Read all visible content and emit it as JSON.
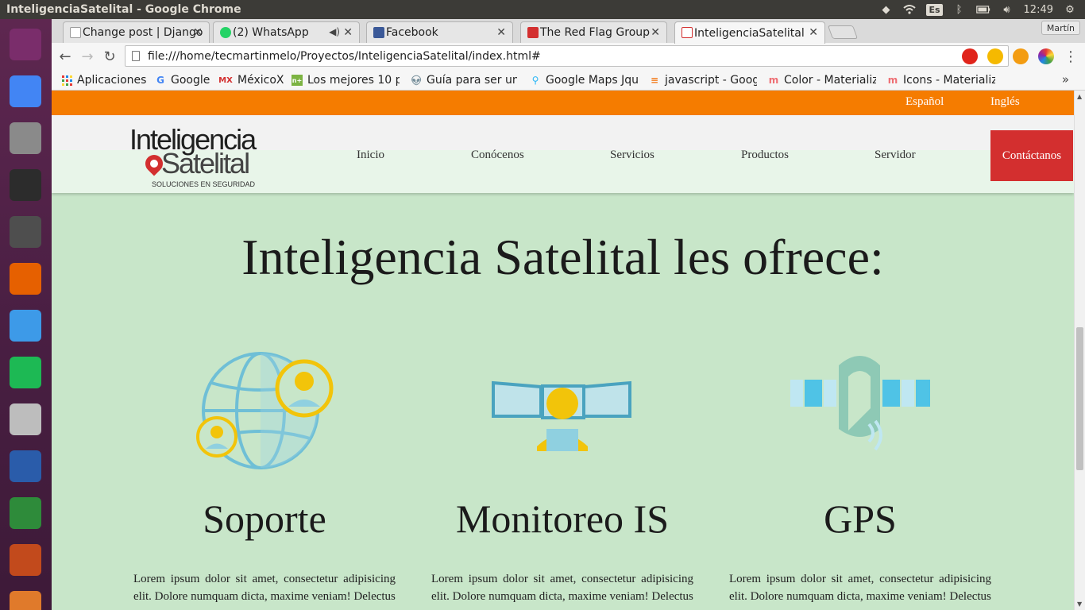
{
  "system": {
    "window_title": "InteligenciaSatelital - Google Chrome",
    "keyboard_lang": "Es",
    "clock": "12:49"
  },
  "launcher": {
    "apps": [
      {
        "name": "ubuntu-dash",
        "color": "#7a2d6b"
      },
      {
        "name": "chrome",
        "color": "#4285f4"
      },
      {
        "name": "files",
        "color": "#8a8a8a"
      },
      {
        "name": "terminal",
        "color": "#2c2c2c"
      },
      {
        "name": "sublime-text",
        "color": "#4e4e4e"
      },
      {
        "name": "firefox",
        "color": "#e66000"
      },
      {
        "name": "dropbox",
        "color": "#3d9ae8"
      },
      {
        "name": "spotify",
        "color": "#1db954"
      },
      {
        "name": "disk",
        "color": "#bdbdbd"
      },
      {
        "name": "writer",
        "color": "#2a5caa"
      },
      {
        "name": "calc",
        "color": "#2e8b3a"
      },
      {
        "name": "impress",
        "color": "#c24a1c"
      },
      {
        "name": "software-center",
        "color": "#e07a2b"
      }
    ]
  },
  "browser": {
    "tabs": [
      {
        "title": "Change post | Django",
        "icon_color": "#bdbdbd"
      },
      {
        "title": "(2) WhatsApp",
        "icon_color": "#25d366"
      },
      {
        "title": "Facebook",
        "icon_color": "#3b5998"
      },
      {
        "title": "The Red Flag Group",
        "icon_color": "#d32f2f"
      },
      {
        "title": "InteligenciaSatelital",
        "icon_color": "#d32f2f"
      }
    ],
    "profile": "Martín",
    "url": "file:///home/tecmartinmelo/Proyectos/InteligenciaSatelital/index.html#",
    "bookmarks": [
      {
        "label": "Aplicaciones",
        "icon": "grid"
      },
      {
        "label": "Google",
        "icon": "G"
      },
      {
        "label": "MéxicoX",
        "icon": "MX"
      },
      {
        "label": "Los mejores 10 p",
        "icon": "n+"
      },
      {
        "label": "Guía para ser un",
        "icon": "alien"
      },
      {
        "label": "Google Maps Jqu",
        "icon": "pin"
      },
      {
        "label": "javascript - Goog",
        "icon": "stack"
      },
      {
        "label": "Color - Materializ",
        "icon": "M"
      },
      {
        "label": "Icons - Materializ",
        "icon": "M"
      }
    ]
  },
  "site": {
    "lang_links": [
      "Español",
      "Inglés"
    ],
    "logo": {
      "line1": "Inteligencia",
      "line2": "Satelital",
      "tagline": "SOLUCIONES EN SEGURIDAD"
    },
    "nav": [
      "Inicio",
      "Conócenos",
      "Servicios",
      "Productos",
      "Servidor"
    ],
    "contact_label": "Contáctanos",
    "heading": "Inteligencia Satelital les ofrece:",
    "services": [
      {
        "title": "Soporte",
        "icon": "globe-users-icon",
        "text": "Lorem ipsum dolor sit amet, consectetur adipisicing elit. Dolore numquam dicta, maxime veniam! Delectus"
      },
      {
        "title": "Monitoreo IS",
        "icon": "monitoring-operator-icon",
        "text": "Lorem ipsum dolor sit amet, consectetur adipisicing elit. Dolore numquam dicta, maxime veniam! Delectus"
      },
      {
        "title": "GPS",
        "icon": "satellite-icon",
        "text": "Lorem ipsum dolor sit amet, consectetur adipisicing elit. Dolore numquam dicta, maxime veniam! Delectus"
      }
    ]
  },
  "colors": {
    "lang_bar": "#f57c00",
    "page_bg": "#c8e6c9",
    "contact_bg": "#d32f2f"
  }
}
